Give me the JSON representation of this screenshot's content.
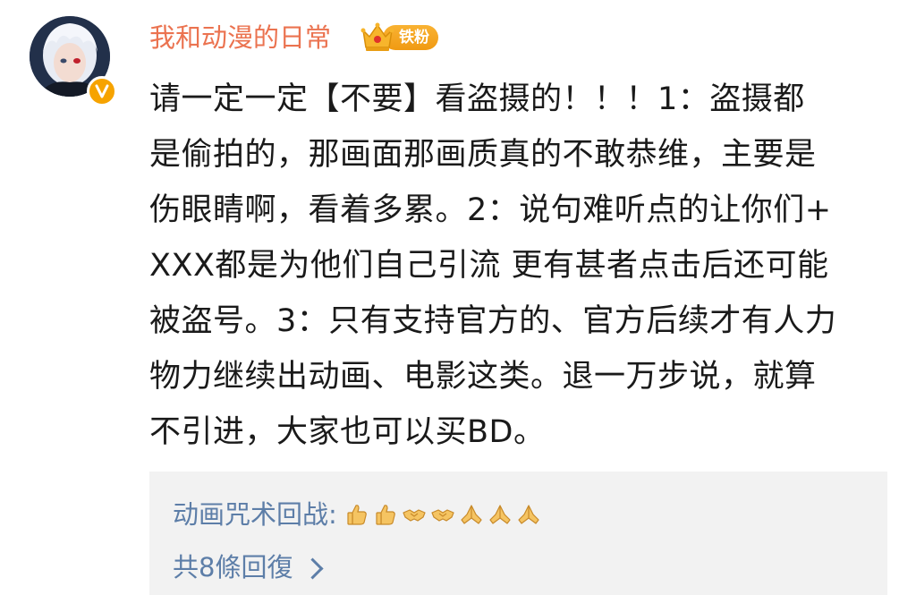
{
  "comment": {
    "author": {
      "name": "我和动漫的日常",
      "fan_badge_label": "铁粉",
      "avatar_icon": "anime-character-avatar-icon",
      "verified_icon": "orange-v-verified-icon"
    },
    "text_lines": [
      "请一定一定【不要】看盗摄的！！！1：盗摄都",
      "是偷拍的，那画面那画质真的不敢恭维，主要是",
      "伤眼睛啊，看着多累。2：说句难听点的让你们+",
      "XXX都是为他们自己引流 更有甚者点击后还可能",
      "被盗号。3：只有支持官方的、官方后续才有人力",
      "物力继续出动画、电影这类。退一万步说，就算",
      "不引进，大家也可以买BD。"
    ]
  },
  "reply_preview": {
    "author": "动画咒术回战",
    "colon": ":",
    "emojis": [
      "thumbs-up-icon",
      "thumbs-up-icon",
      "handshake-icon",
      "handshake-icon",
      "praying-hands-icon",
      "praying-hands-icon",
      "praying-hands-icon"
    ],
    "total_replies_label": "共8條回復"
  },
  "colors": {
    "username": "#eb7350",
    "link_blue": "#5d7ea8",
    "badge_orange": "#f6a300",
    "reply_bg": "#f2f2f2"
  }
}
